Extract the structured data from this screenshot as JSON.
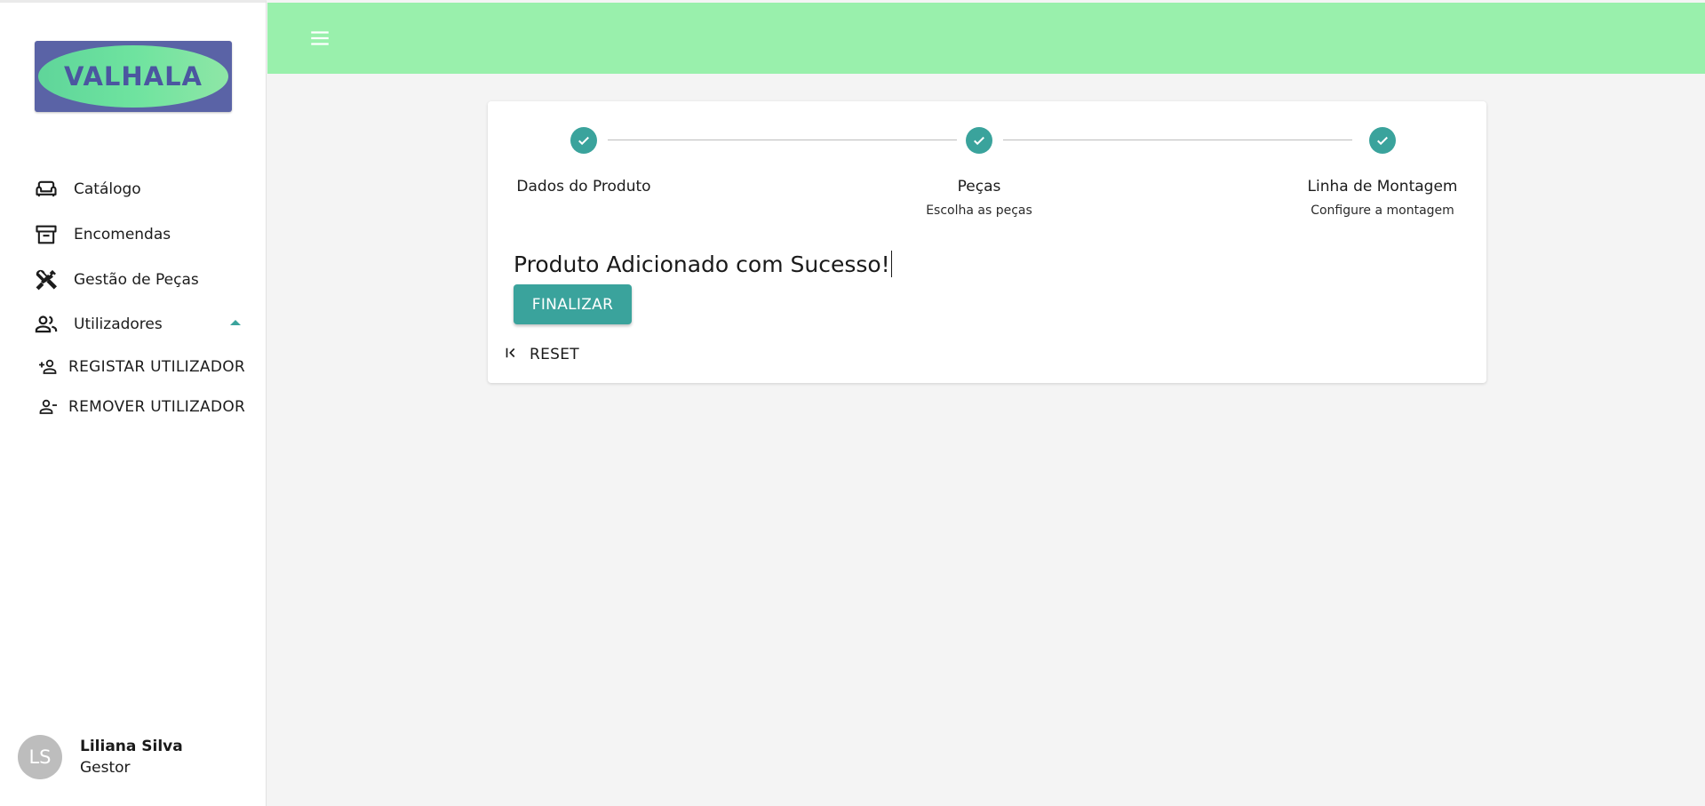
{
  "brand": {
    "logo_text": "VALHALA"
  },
  "sidebar": {
    "items": [
      {
        "label": "Catálogo",
        "icon": "sofa-icon"
      },
      {
        "label": "Encomendas",
        "icon": "archive-box-icon"
      },
      {
        "label": "Gestão de Peças",
        "icon": "tools-icon"
      },
      {
        "label": "Utilizadores",
        "icon": "users-icon",
        "expanded": true
      }
    ],
    "subitems": [
      {
        "label": "REGISTAR UTILIZADOR",
        "icon": "person-add-icon"
      },
      {
        "label": "REMOVER UTILIZADOR",
        "icon": "person-remove-icon"
      }
    ]
  },
  "user": {
    "initials": "LS",
    "name": "Liliana Silva",
    "role": "Gestor"
  },
  "stepper": {
    "steps": [
      {
        "label": "Dados do Produto",
        "sublabel": "",
        "completed": true
      },
      {
        "label": "Peças",
        "sublabel": "Escolha as peças",
        "completed": true
      },
      {
        "label": "Linha de Montagem",
        "sublabel": "Configure a montagem",
        "completed": true
      }
    ]
  },
  "content": {
    "message": "Produto Adicionado com Sucesso!",
    "finish_label": "FINALIZAR",
    "reset_label": "RESET"
  },
  "colors": {
    "accent": "#3aa39c",
    "topbar": "#99f0ac",
    "logo_bg": "#5a63a6"
  }
}
